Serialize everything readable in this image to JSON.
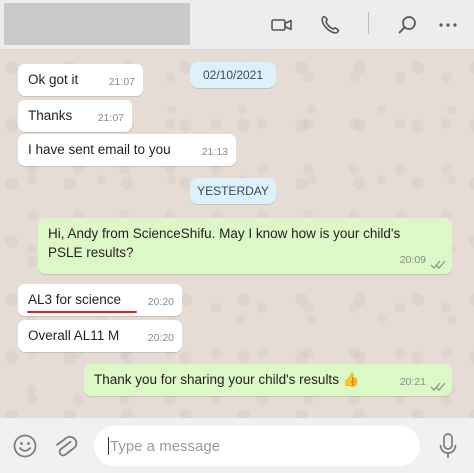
{
  "header": {
    "contact_name": "",
    "icons": [
      "video-call-icon",
      "voice-call-icon",
      "search-icon",
      "more-options-icon"
    ]
  },
  "chat": {
    "date_labels": [
      "02/10/2021",
      "YESTERDAY"
    ],
    "messages": [
      {
        "direction": "incoming",
        "text": "Ok got it",
        "time": "21:07"
      },
      {
        "direction": "incoming",
        "text": "Thanks",
        "time": "21:07"
      },
      {
        "direction": "incoming",
        "text": "I have sent email to you",
        "time": "21:13"
      },
      {
        "direction": "outgoing",
        "text": "Hi, Andy from ScienceShifu. May I know how is your child's\nPSLE results?",
        "time": "20:09",
        "status": "read"
      },
      {
        "direction": "incoming",
        "text": "AL3 for science",
        "time": "20:20",
        "annotation": "red underline"
      },
      {
        "direction": "incoming",
        "text": "Overall AL11 M",
        "time": "20:20"
      },
      {
        "direction": "outgoing",
        "text": "Thank you for sharing your child's results 👍",
        "time": "20:21",
        "status": "read"
      }
    ]
  },
  "composer": {
    "placeholder": "Type a message",
    "icons": [
      "emoji-icon",
      "attach-icon",
      "microphone-icon"
    ]
  },
  "colors": {
    "chat_background": "#e5ddd5",
    "incoming_bubble": "#ffffff",
    "outgoing_bubble": "#dcf8c6",
    "date_pill": "#dcf1fa",
    "read_ticks": "#8a9a8a",
    "annotation_underline": "#e02020"
  }
}
